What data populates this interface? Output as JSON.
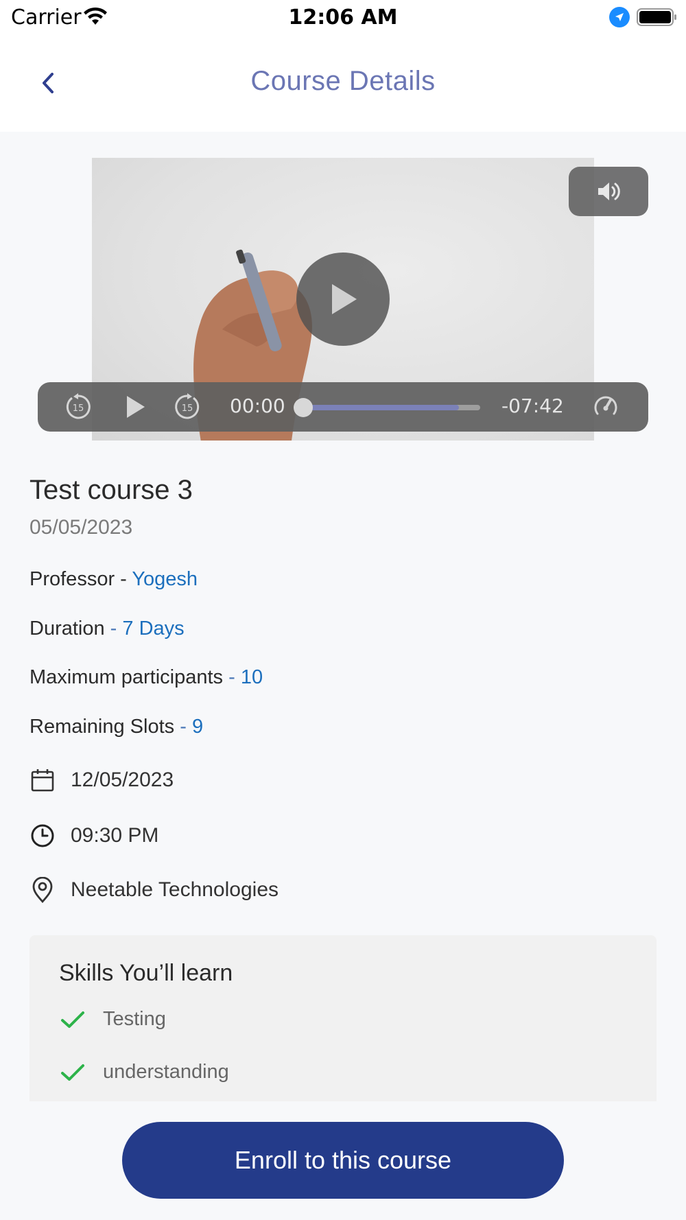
{
  "status_bar": {
    "carrier": "Carrier",
    "time": "12:06 AM",
    "icons": [
      "wifi-icon",
      "location-arrow-icon",
      "battery-icon"
    ]
  },
  "nav": {
    "title": "Course Details",
    "back_icon": "chevron-left-icon"
  },
  "video": {
    "current_time": "00:00",
    "remaining_time": "-07:42",
    "progress": 0.0,
    "buffered": 0.88,
    "icons": [
      "speaker-icon",
      "play-icon",
      "rewind-15-icon",
      "forward-15-icon",
      "playback-speed-icon"
    ]
  },
  "course": {
    "title": "Test course 3",
    "date": "05/05/2023",
    "professor_label": "Professor - ",
    "professor": "Yogesh",
    "duration_label": "Duration",
    "duration_sep": " - ",
    "duration": "7 Days",
    "max_participants_label": "Maximum participants",
    "max_participants_sep": " - ",
    "max_participants": "10",
    "remaining_slots_label": "Remaining Slots",
    "remaining_slots_sep": " - ",
    "remaining_slots": "9",
    "event_date": "12/05/2023",
    "event_time": "09:30 PM",
    "location": "Neetable Technologies"
  },
  "skills": {
    "title": "Skills You’ll learn",
    "items": [
      "Testing",
      "understanding"
    ]
  },
  "enroll_label": "Enroll to this course",
  "colors": {
    "accent": "#243b8a",
    "nav_title": "#6b76b4",
    "value_link": "#1c6fbd",
    "check": "#2db34a"
  }
}
